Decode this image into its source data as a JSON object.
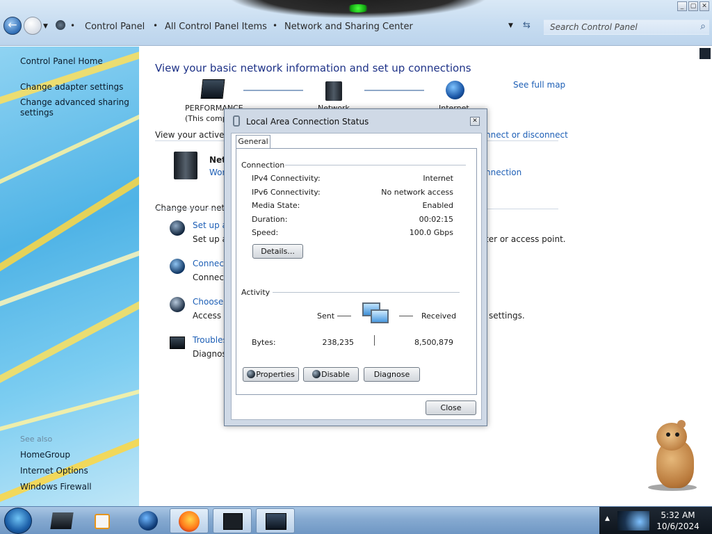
{
  "window": {
    "min": "_",
    "max": "▢",
    "close": "✕"
  },
  "addressbar": {
    "breadcrumbs": [
      "Control Panel",
      "All Control Panel Items",
      "Network and Sharing Center"
    ],
    "search_placeholder": "Search Control Panel"
  },
  "leftpane": {
    "home": "Control Panel Home",
    "tasks": [
      "Change adapter settings",
      "Change advanced sharing",
      "settings"
    ],
    "see_also_heading": "See also",
    "see_also": [
      "HomeGroup",
      "Internet Options",
      "Windows Firewall"
    ]
  },
  "main": {
    "title": "View your basic network information and set up connections",
    "see_full_map": "See full map",
    "map_nodes": [
      "PERFORMANCE",
      "(This comp",
      "Network",
      "Internet"
    ],
    "active_networks_heading": "View your active ne",
    "connect_or_disconnect": "nnect or disconnect",
    "network_name": "Net",
    "network_type": "Wor",
    "connection_link": "nnection",
    "change_heading": "Change your netw",
    "tasks": [
      {
        "link": "Set up a",
        "desc": "Set up a"
      },
      {
        "link": "Connect",
        "desc": "Connect"
      },
      {
        "link": "Choose",
        "desc": "Access fi"
      },
      {
        "link": "Troubles",
        "desc": "Diagnos"
      }
    ],
    "right_fragments": [
      "ter or access point.",
      "settings."
    ]
  },
  "dialog": {
    "title": "Local Area Connection Status",
    "tab": "General",
    "connection_group": "Connection",
    "rows": [
      {
        "label": "IPv4 Connectivity:",
        "value": "Internet"
      },
      {
        "label": "IPv6 Connectivity:",
        "value": "No network access"
      },
      {
        "label": "Media State:",
        "value": "Enabled"
      },
      {
        "label": "Duration:",
        "value": "00:02:15"
      },
      {
        "label": "Speed:",
        "value": "100.0 Gbps"
      }
    ],
    "details_button": "Details...",
    "activity_group": "Activity",
    "sent_label": "Sent",
    "received_label": "Received",
    "bytes_label": "Bytes:",
    "bytes_sent": "238,235",
    "bytes_received": "8,500,879",
    "properties_button": "Properties",
    "disable_button": "Disable",
    "diagnose_button": "Diagnose",
    "close_button": "Close"
  },
  "taskbar": {
    "time": "5:32 AM",
    "date": "10/6/2024"
  }
}
